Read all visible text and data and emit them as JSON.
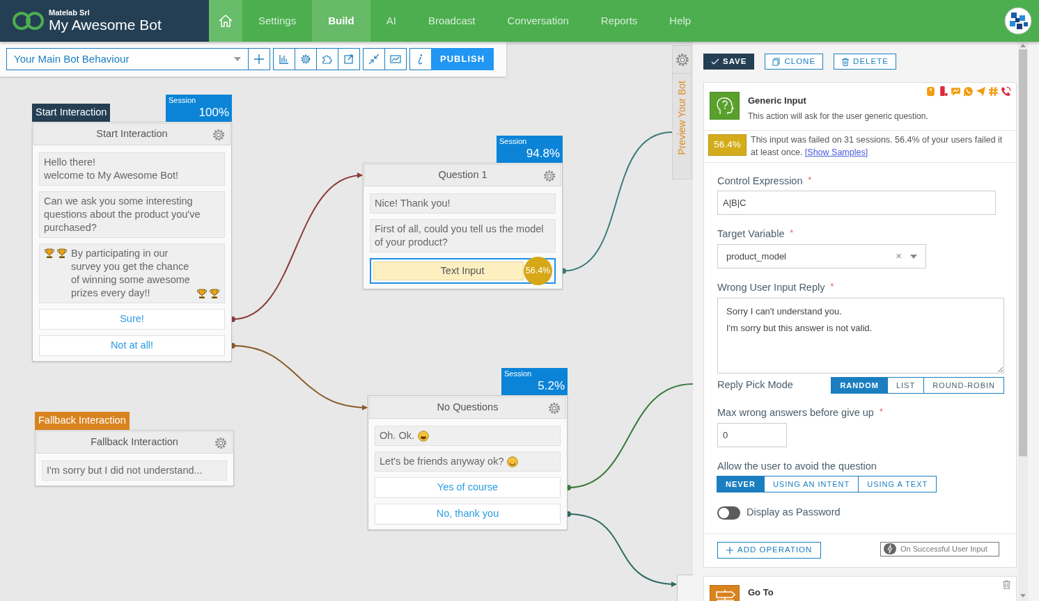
{
  "brand": {
    "company": "Matelab Srl",
    "title": "My Awesome Bot"
  },
  "nav": [
    {
      "label": "Settings",
      "selected": false
    },
    {
      "label": "Build",
      "selected": true
    },
    {
      "label": "AI",
      "selected": false
    },
    {
      "label": "Broadcast",
      "selected": false
    },
    {
      "label": "Conversation",
      "selected": false
    },
    {
      "label": "Reports",
      "selected": false
    },
    {
      "label": "Help",
      "selected": false
    }
  ],
  "toolbar": {
    "flow_select": "Your Main Bot Behaviour",
    "publish": "PUBLISH"
  },
  "nodes": [
    {
      "tag": {
        "label": "Start Interaction",
        "color": "#243f54"
      },
      "session": {
        "label": "Session",
        "value": "100%"
      },
      "title": "Start Interaction",
      "items": [
        {
          "kind": "message",
          "text": "Hello there!\nwelcome to My Awesome Bot!"
        },
        {
          "kind": "message",
          "text": "Can we ask you some interesting questions about the product you've purchased?"
        },
        {
          "kind": "message",
          "text": "By participating in our survey you get the chance of winning some awesome prizes every day!!"
        },
        {
          "kind": "button",
          "text": "Sure!"
        },
        {
          "kind": "button",
          "text": "Not at all!"
        }
      ]
    },
    {
      "session": {
        "label": "Session",
        "value": "94.8%"
      },
      "title": "Question 1",
      "items": [
        {
          "kind": "message",
          "text": "Nice! Thank you!"
        },
        {
          "kind": "message",
          "text": "First of all, could you tell us the model of your product?"
        },
        {
          "kind": "input",
          "text": "Text Input",
          "badge": "56.4%",
          "selected": true
        }
      ]
    },
    {
      "tag": {
        "label": "Fallback Interaction",
        "color": "#d9831f"
      },
      "title": "Fallback Interaction",
      "items": [
        {
          "kind": "message",
          "text": "I'm sorry but I did not understand..."
        }
      ]
    },
    {
      "session": {
        "label": "Session",
        "value": "5.2%"
      },
      "title": "No Questions",
      "items": [
        {
          "kind": "message",
          "text": "Oh. Ok."
        },
        {
          "kind": "message",
          "text": "Let's be friends anyway ok?"
        },
        {
          "kind": "button",
          "text": "Yes of course"
        },
        {
          "kind": "button",
          "text": "No, thank you"
        }
      ]
    }
  ],
  "preview_tab": {
    "label": "Preview Your Bot"
  },
  "panel": {
    "actions": [
      {
        "kind": "save",
        "label": "SAVE"
      },
      {
        "kind": "clone",
        "label": "CLONE"
      },
      {
        "kind": "delete",
        "label": "DELETE"
      }
    ],
    "action_card": {
      "title": "Generic Input",
      "description": "This action will ask for the user generic question.",
      "stats": {
        "badge": "56.4%",
        "text": "This input was failed on 31 sessions. 56.4% of your users failed it at least once.",
        "link": "[Show Samples]"
      },
      "control_expression": {
        "label": "Control Expression",
        "required_mark": "*",
        "value": "A|B|C"
      },
      "target_variable": {
        "label": "Target Variable",
        "required_mark": "*",
        "value": "product_model",
        "clear": "×"
      },
      "wrong_reply": {
        "label": "Wrong User Input Reply",
        "required_mark": "*",
        "value": "Sorry I can't understand you.\nI'm sorry but this answer is not valid."
      },
      "reply_pick_mode": {
        "label": "Reply Pick Mode",
        "options": [
          {
            "label": "RANDOM",
            "selected": true
          },
          {
            "label": "LIST",
            "selected": false
          },
          {
            "label": "ROUND-ROBIN",
            "selected": false
          }
        ]
      },
      "max_wrong": {
        "label": "Max wrong answers before give up",
        "required_mark": "*",
        "value": "0"
      },
      "avoid_question": {
        "label": "Allow the user to avoid the question",
        "options": [
          {
            "label": "NEVER",
            "selected": true
          },
          {
            "label": "USING AN INTENT",
            "selected": false
          },
          {
            "label": "USING A TEXT",
            "selected": false
          }
        ]
      },
      "display_password": {
        "label": "Display as Password",
        "on": false
      },
      "add_operation": "ADD OPERATION",
      "trigger": "On Successful User Input"
    },
    "next_card": {
      "title": "Go To"
    }
  }
}
